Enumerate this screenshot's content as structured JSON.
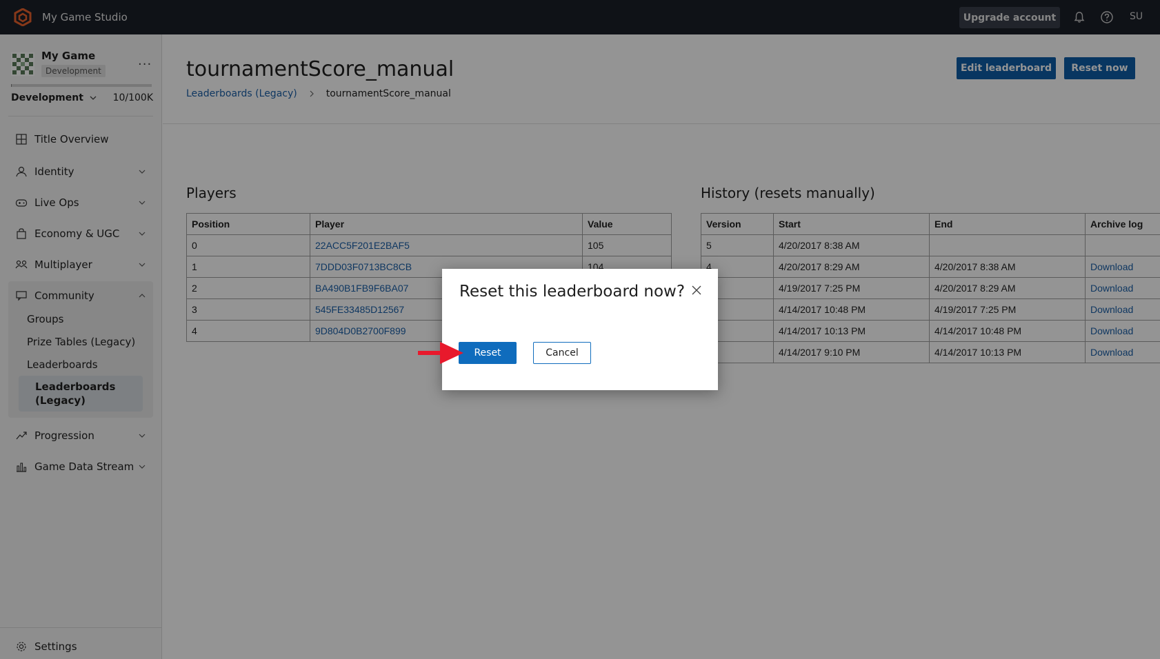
{
  "topbar": {
    "studio_name": "My Game Studio",
    "upgrade_label": "Upgrade account",
    "user_initials": "SU"
  },
  "sidebar": {
    "game_name": "My Game",
    "game_env_badge": "Development",
    "more_label": "...",
    "env_selector": "Development",
    "usage": "10/100K",
    "usage_fraction": 0.0001,
    "items": [
      {
        "label": "Title Overview",
        "icon": "grid-icon"
      },
      {
        "label": "Identity",
        "icon": "identity-icon"
      },
      {
        "label": "Live Ops",
        "icon": "gamepad-icon"
      },
      {
        "label": "Economy & UGC",
        "icon": "shopping-bag-icon"
      },
      {
        "label": "Multiplayer",
        "icon": "people-icon"
      },
      {
        "label": "Community",
        "icon": "chat-icon"
      },
      {
        "label": "Progression",
        "icon": "trend-icon"
      },
      {
        "label": "Game Data Stream",
        "icon": "bar-chart-icon"
      }
    ],
    "community_subitems": [
      "Groups",
      "Prize Tables (Legacy)",
      "Leaderboards"
    ],
    "active_subitem_line1": "Leaderboards",
    "active_subitem_line2": "(Legacy)",
    "settings_label": "Settings"
  },
  "main": {
    "title": "tournamentScore_manual",
    "edit_button": "Edit leaderboard",
    "reset_button": "Reset now",
    "breadcrumb": {
      "parent": "Leaderboards (Legacy)",
      "current": "tournamentScore_manual"
    },
    "players": {
      "title": "Players",
      "headers": [
        "Position",
        "Player",
        "Value"
      ],
      "rows": [
        [
          "0",
          "22ACC5F201E2BAF5",
          "105"
        ],
        [
          "1",
          "7DDD03F0713BC8CB",
          "104"
        ],
        [
          "2",
          "BA490B1FB9F6BA07",
          ""
        ],
        [
          "3",
          "545FE33485D12567",
          ""
        ],
        [
          "4",
          "9D804D0B2700F899",
          ""
        ]
      ]
    },
    "history": {
      "title": "History (resets manually)",
      "headers": [
        "Version",
        "Start",
        "End",
        "Archive log"
      ],
      "rows": [
        [
          "5",
          "4/20/2017 8:38 AM",
          "",
          ""
        ],
        [
          "4",
          "4/20/2017 8:29 AM",
          "4/20/2017 8:38 AM",
          "Download"
        ],
        [
          "",
          "4/19/2017 7:25 PM",
          "4/20/2017 8:29 AM",
          "Download"
        ],
        [
          "",
          "4/14/2017 10:48 PM",
          "4/19/2017 7:25 PM",
          "Download"
        ],
        [
          "",
          "4/14/2017 10:13 PM",
          "4/14/2017 10:48 PM",
          "Download"
        ],
        [
          "",
          "4/14/2017 9:10 PM",
          "4/14/2017 10:13 PM",
          "Download"
        ]
      ]
    }
  },
  "dialog": {
    "title": "Reset this leaderboard now?",
    "reset_label": "Reset",
    "cancel_label": "Cancel"
  },
  "colors": {
    "topbar_bg": "#1b1f29",
    "primary": "#0f5ea8",
    "dialog_primary": "#0f6cbd",
    "link": "#1a5fa8",
    "brand_orange": "#e8612c",
    "arrow_red": "#e8192c"
  }
}
